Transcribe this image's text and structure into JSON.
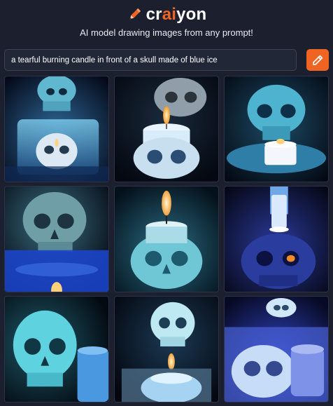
{
  "header": {
    "logo_prefix": "cr",
    "logo_accent": "ai",
    "logo_suffix": "yon",
    "tagline": "AI model drawing images from any prompt!"
  },
  "prompt": {
    "value": "a tearful burning candle in front of a skull made of blue ice"
  },
  "draw_button": {
    "icon": "pencil-icon"
  },
  "colors": {
    "background": "#1b1f2e",
    "accent": "#f06423",
    "input_background": "#222738",
    "input_border": "#3b4257"
  },
  "results": [
    {
      "subject": "skull with candle",
      "icon": "generated-image"
    },
    {
      "subject": "skull with candle",
      "icon": "generated-image"
    },
    {
      "subject": "skull with candle",
      "icon": "generated-image"
    },
    {
      "subject": "skull with candle",
      "icon": "generated-image"
    },
    {
      "subject": "skull with candle",
      "icon": "generated-image"
    },
    {
      "subject": "skull with candle",
      "icon": "generated-image"
    },
    {
      "subject": "skull with candle",
      "icon": "generated-image"
    },
    {
      "subject": "skull with candle",
      "icon": "generated-image"
    },
    {
      "subject": "skull with candle",
      "icon": "generated-image"
    }
  ]
}
